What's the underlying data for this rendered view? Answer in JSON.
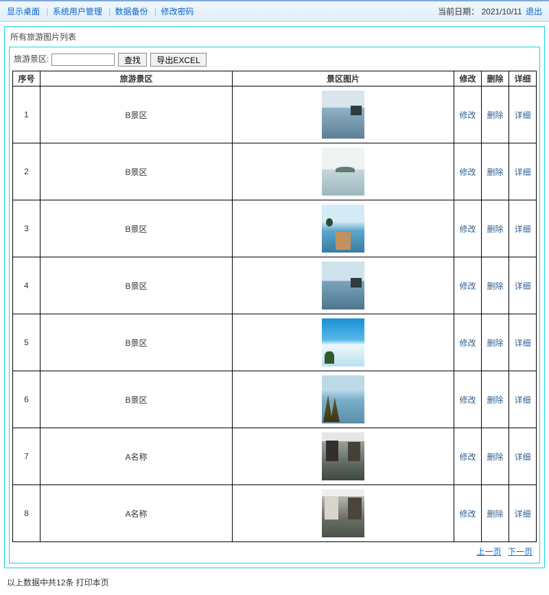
{
  "topbar": {
    "links": [
      "显示桌面",
      "系统用户管理",
      "数据备份",
      "修改密码"
    ],
    "date_label": "当前日期：",
    "date_value": "2021/10/11",
    "logout": "退出"
  },
  "panel": {
    "title": "所有旅游图片列表"
  },
  "search": {
    "label": "旅游景区:",
    "placeholder": "",
    "value": "",
    "find_btn": "查找",
    "export_btn": "导出EXCEL"
  },
  "table": {
    "headers": {
      "seq": "序号",
      "scenic": "旅游景区",
      "image": "景区图片",
      "edit": "修改",
      "delete": "删除",
      "detail": "详细"
    },
    "actions": {
      "edit": "修改",
      "delete": "删除",
      "detail": "详细"
    },
    "rows": [
      {
        "seq": "1",
        "scenic": "B景区",
        "thumb": "t1"
      },
      {
        "seq": "2",
        "scenic": "B景区",
        "thumb": "t2"
      },
      {
        "seq": "3",
        "scenic": "B景区",
        "thumb": "t3"
      },
      {
        "seq": "4",
        "scenic": "B景区",
        "thumb": "t4"
      },
      {
        "seq": "5",
        "scenic": "B景区",
        "thumb": "t5"
      },
      {
        "seq": "6",
        "scenic": "B景区",
        "thumb": "t6"
      },
      {
        "seq": "7",
        "scenic": "A名称",
        "thumb": "t7"
      },
      {
        "seq": "8",
        "scenic": "A名称",
        "thumb": "t8"
      }
    ]
  },
  "pager": {
    "prev": "上一页",
    "next": "下一页"
  },
  "footer": {
    "summary_prefix": "以上数据中共",
    "count": "12",
    "summary_suffix": "条",
    "print": "打印本页"
  }
}
